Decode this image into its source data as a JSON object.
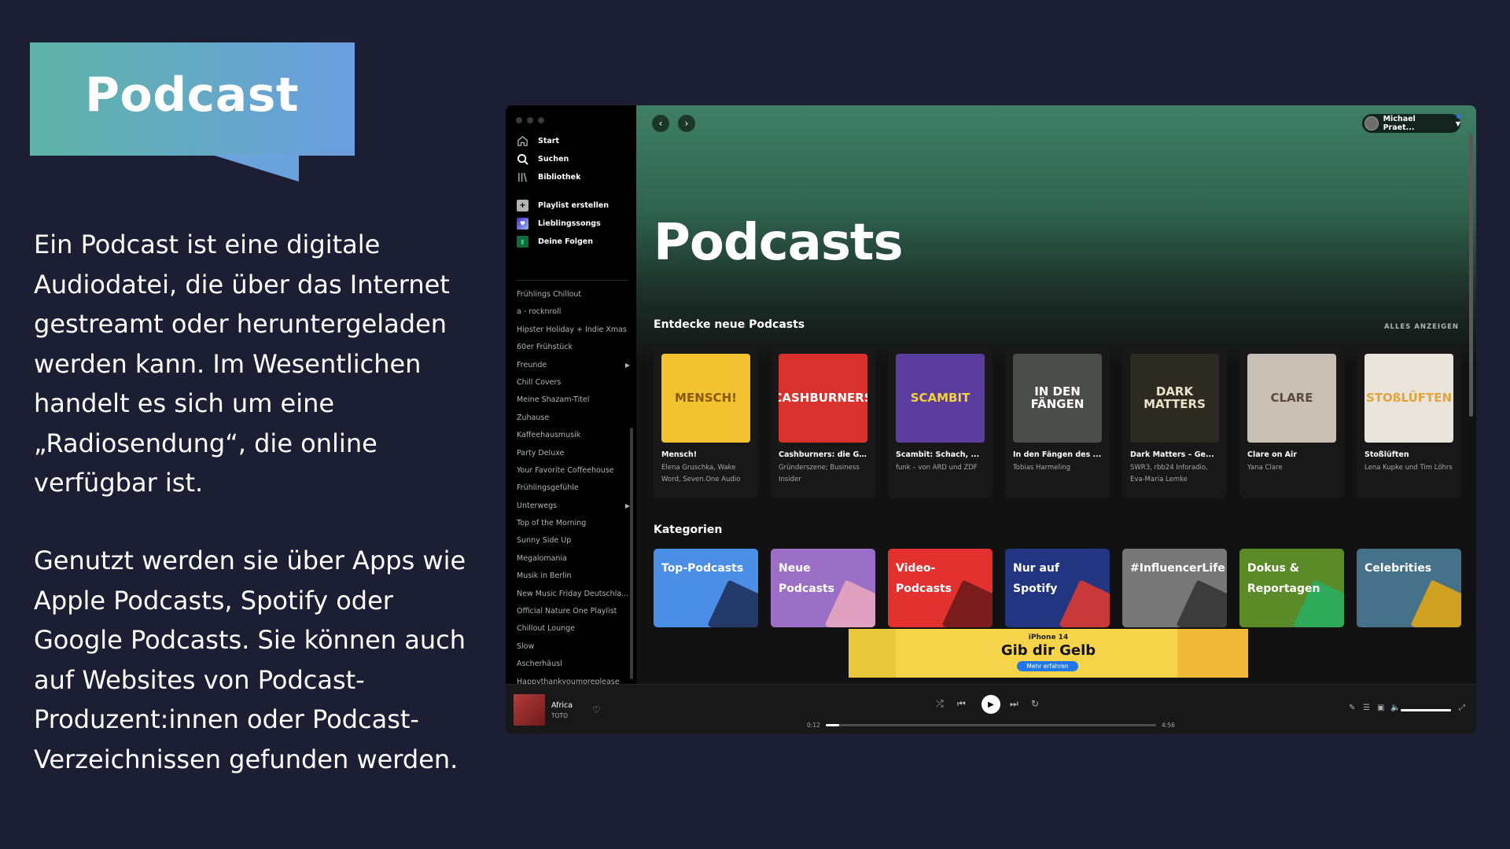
{
  "slide": {
    "title": "Podcast",
    "paragraph_1": "Ein Podcast ist eine digitale Audiodatei, die über das Internet gestreamt oder heruntergeladen werden kann. Im Wesentlichen handelt es sich um eine „Radiosendung“, die online verfügbar ist.",
    "paragraph_2": "Genutzt werden sie über Apps wie Apple Podcasts, Spotify oder Google Podcasts. Sie können auch auf Websites von Podcast-Produzent:innen oder Podcast-Verzeichnissen gefunden werden."
  },
  "spotify": {
    "nav": [
      {
        "label": "Start",
        "icon": "home-icon"
      },
      {
        "label": "Suchen",
        "icon": "search-icon"
      },
      {
        "label": "Bibliothek",
        "icon": "library-icon"
      }
    ],
    "actions": [
      {
        "label": "Playlist erstellen",
        "icon": "plus-icon"
      },
      {
        "label": "Lieblingssongs",
        "icon": "heart-icon"
      },
      {
        "label": "Deine Folgen",
        "icon": "bookmark-icon"
      }
    ],
    "playlists": [
      "Frühlings Chillout",
      "a - rocknroll",
      "Hipster Holiday + Indie Xmas",
      "60er Frühstück",
      "Freunde",
      "Chill Covers",
      "Meine Shazam-Titel",
      "Zuhause",
      "Kaffeehausmusik",
      "Party Deluxe",
      "Your Favorite Coffeehouse",
      "Frühlingsgefühle",
      "Unterwegs",
      "Top of the Morning",
      "Sunny Side Up",
      "Megalomania",
      "Musik in Berlin",
      "New Music Friday Deutschla...",
      "Official Nature One Playlist",
      "Chillout Lounge",
      "Slow",
      "Ascherhäusl",
      "Happythankyoumoreplease"
    ],
    "user_name": "Michael Praet...",
    "page_title": "Podcasts",
    "section_discover": "Entdecke neue Podcasts",
    "show_all": "ALLES ANZEIGEN",
    "podcasts": [
      {
        "cover_text": "MENSCH!",
        "title": "Mensch!",
        "sub": "Elena Gruschka, Wake Word, Seven.One Audio",
        "bg": "#f2c230",
        "fg": "#8a5a00"
      },
      {
        "cover_text": "CASHBURNERS",
        "title": "Cashburners: die G...",
        "sub": "Gründerszene; Business Insider",
        "bg": "#d9322e",
        "fg": "#ffffff"
      },
      {
        "cover_text": "SCAMBIT",
        "title": "Scambit: Schach, ...",
        "sub": "funk – von ARD und ZDF",
        "bg": "#5b3d9e",
        "fg": "#f4d23c"
      },
      {
        "cover_text": "IN DEN FÄNGEN",
        "title": "In den Fängen des ...",
        "sub": "Tobias Harmeling",
        "bg": "#4a4d4a",
        "fg": "#ffffff"
      },
      {
        "cover_text": "DARK MATTERS",
        "title": "Dark Matters – Ge...",
        "sub": "SWR3, rbb24 Inforadio, Eva-Maria Lemke",
        "bg": "#2d2a22",
        "fg": "#e8e2c8"
      },
      {
        "cover_text": "CLARE",
        "title": "Clare on Air",
        "sub": "Yana Clare",
        "bg": "#c8c0b4",
        "fg": "#5a4a3e"
      },
      {
        "cover_text": "STOßLÜFTEN",
        "title": "Stoßlüften",
        "sub": "Lena Kupke und Tim Löhrs",
        "bg": "#e9e4dc",
        "fg": "#e0a43a"
      }
    ],
    "section_categories": "Kategorien",
    "categories": [
      {
        "label": "Top-Podcasts",
        "bg": "#4a8ee6",
        "tile": "#233a6a"
      },
      {
        "label": "Neue Podcasts",
        "bg": "#9a6fc6",
        "tile": "#e0a0c0"
      },
      {
        "label": "Video-Podcasts",
        "bg": "#e2312f",
        "tile": "#7a1c1c"
      },
      {
        "label": "Nur auf Spotify",
        "bg": "#223580",
        "tile": "#c83a3a"
      },
      {
        "label": "#InfluencerLife",
        "bg": "#777777",
        "tile": "#3c3c3c"
      },
      {
        "label": "Dokus & Reportagen",
        "bg": "#5b8a28",
        "tile": "#2eaa5a"
      },
      {
        "label": "Celebrities",
        "bg": "#45728a",
        "tile": "#d0a020"
      }
    ],
    "ad": {
      "brand": "iPhone 14",
      "title": "Gib dir Gelb",
      "button": "Mehr erfahren"
    },
    "player": {
      "track": "Africa",
      "artist": "TOTO",
      "elapsed": "0:12",
      "duration": "4:56",
      "progress": 0.04,
      "volume": 1.0
    }
  }
}
